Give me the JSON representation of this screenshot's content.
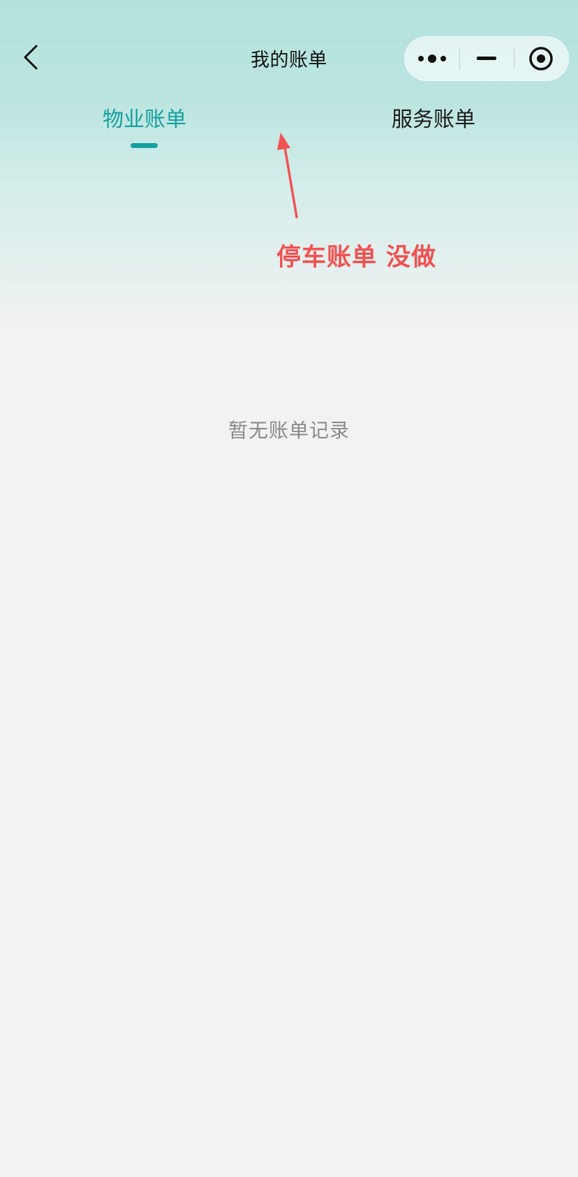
{
  "nav": {
    "title": "我的账单",
    "back_icon": "chevron-left-icon",
    "capsule": {
      "more_icon": "more-dots-icon",
      "minimize_icon": "minimize-icon",
      "close_icon": "target-circle-icon"
    }
  },
  "tabs": [
    {
      "label": "物业账单",
      "active": true
    },
    {
      "label": "服务账单",
      "active": false
    }
  ],
  "annotation": {
    "text": "停车账单 没做",
    "color": "#f05252"
  },
  "empty_state": {
    "text": "暂无账单记录"
  },
  "colors": {
    "accent": "#16a0a0",
    "header_gradient_top": "#b3e2dc",
    "page_background": "#f2f2f2"
  }
}
